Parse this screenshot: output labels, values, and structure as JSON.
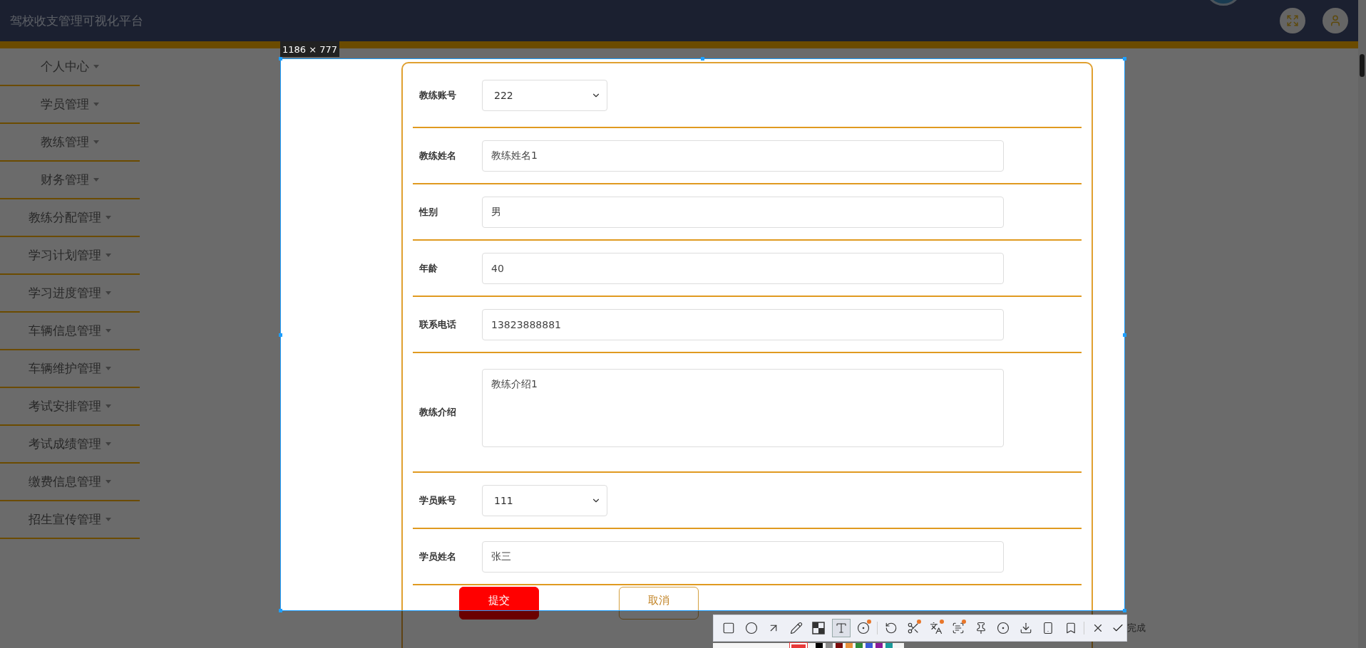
{
  "header": {
    "title": "驾校收支管理可视化平台"
  },
  "sidebar": {
    "items": [
      {
        "label": "个人中心"
      },
      {
        "label": "学员管理"
      },
      {
        "label": "教练管理"
      },
      {
        "label": "财务管理"
      },
      {
        "label": "教练分配管理"
      },
      {
        "label": "学习计划管理"
      },
      {
        "label": "学习进度管理"
      },
      {
        "label": "车辆信息管理"
      },
      {
        "label": "车辆维护管理"
      },
      {
        "label": "考试安排管理"
      },
      {
        "label": "考试成绩管理"
      },
      {
        "label": "缴费信息管理"
      },
      {
        "label": "招生宣传管理"
      }
    ]
  },
  "form": {
    "fields": [
      {
        "label": "教练账号",
        "kind": "select",
        "value": "222"
      },
      {
        "label": "教练姓名",
        "kind": "input",
        "value": "教练姓名1"
      },
      {
        "label": "性别",
        "kind": "input",
        "value": "男"
      },
      {
        "label": "年龄",
        "kind": "input",
        "value": "40"
      },
      {
        "label": "联系电话",
        "kind": "input",
        "value": "13823888881"
      },
      {
        "label": "教练介绍",
        "kind": "textarea",
        "value": "教练介绍1"
      },
      {
        "label": "学员账号",
        "kind": "select",
        "value": "111"
      },
      {
        "label": "学员姓名",
        "kind": "input",
        "value": "张三"
      }
    ],
    "buttons": [
      {
        "label": "提交",
        "kind": "primary"
      },
      {
        "label": "取消",
        "kind": "secondary"
      }
    ]
  },
  "capture": {
    "size_label": "1186 × 777",
    "tools": [
      {
        "kind": "rect",
        "selected": false,
        "badge": false
      },
      {
        "kind": "ellipse",
        "selected": false,
        "badge": false
      },
      {
        "kind": "arrow",
        "selected": false,
        "badge": false
      },
      {
        "kind": "pencil",
        "selected": false,
        "badge": false
      },
      {
        "kind": "mosaic",
        "selected": false,
        "badge": false
      },
      {
        "kind": "text",
        "selected": true,
        "badge": false
      },
      {
        "kind": "number",
        "selected": false,
        "badge": true
      },
      {
        "kind": "undo",
        "selected": false,
        "badge": false
      },
      {
        "kind": "cut",
        "selected": false,
        "badge": true
      },
      {
        "kind": "translate",
        "selected": false,
        "badge": true
      },
      {
        "kind": "ocr",
        "selected": false,
        "badge": true
      },
      {
        "kind": "pin",
        "selected": false,
        "badge": false
      },
      {
        "kind": "record",
        "selected": false,
        "badge": false
      },
      {
        "kind": "download",
        "selected": false,
        "badge": false
      },
      {
        "kind": "phone",
        "selected": false,
        "badge": false
      },
      {
        "kind": "bookmark",
        "selected": false,
        "badge": false
      }
    ],
    "done_label": "完成",
    "palette": [
      {
        "color": "#e83a3a",
        "selected": true
      },
      {
        "color": "#000000",
        "selected": false
      },
      {
        "color": "#8a8a8a",
        "selected": false
      },
      {
        "color": "#7a0a0a",
        "selected": false
      },
      {
        "color": "#e8913a",
        "selected": false
      },
      {
        "color": "#2e8b3a",
        "selected": false
      },
      {
        "color": "#3a5ad8",
        "selected": false
      },
      {
        "color": "#8a1a9a",
        "selected": false
      },
      {
        "color": "#1a9a9a",
        "selected": false
      }
    ]
  }
}
